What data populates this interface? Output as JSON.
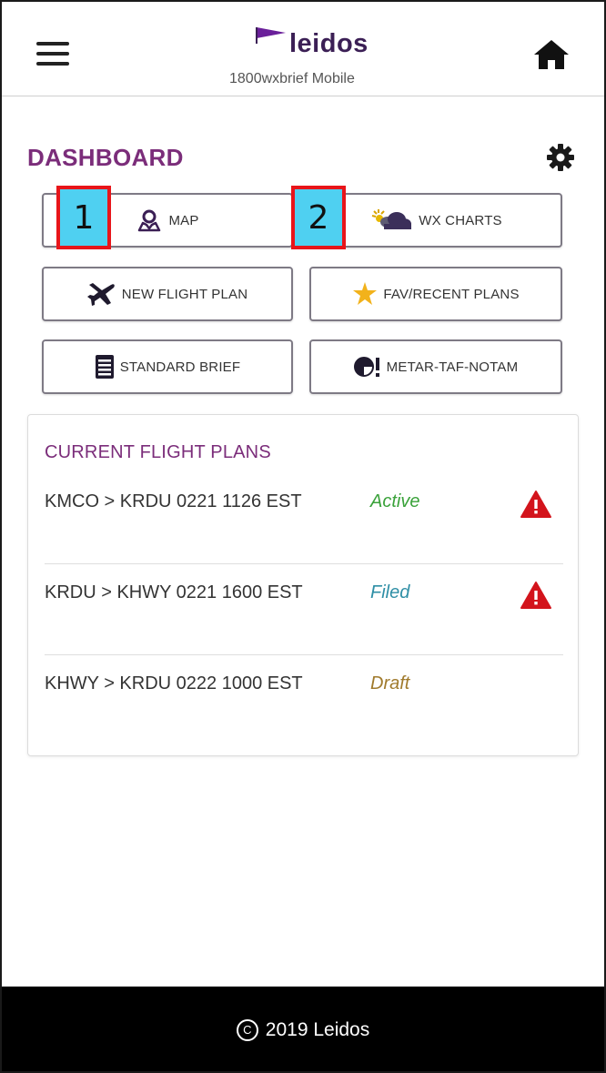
{
  "header": {
    "brand_name": "leidos",
    "subtitle": "1800wxbrief Mobile"
  },
  "dashboard": {
    "title": "DASHBOARD"
  },
  "buttons": {
    "map": "MAP",
    "wx_charts": "WX CHARTS",
    "new_flight_plan": "NEW FLIGHT PLAN",
    "fav_recent_plans": "FAV/RECENT PLANS",
    "standard_brief": "STANDARD BRIEF",
    "metar_taf_notam": "METAR-TAF-NOTAM"
  },
  "markers": {
    "m1": "1",
    "m2": "2"
  },
  "current_flight_plans": {
    "title": "CURRENT FLIGHT PLANS",
    "plans": [
      {
        "route": "KMCO > KRDU 0221 1126 EST",
        "status": "Active",
        "status_color": "#3aa23a",
        "warning": true
      },
      {
        "route": "KRDU > KHWY 0221 1600 EST",
        "status": "Filed",
        "status_color": "#2f8fa6",
        "warning": true
      },
      {
        "route": "KHWY > KRDU 0222 1000 EST",
        "status": "Draft",
        "status_color": "#a07a2c",
        "warning": false
      }
    ]
  },
  "footer": {
    "copyright_symbol": "C",
    "text": "2019 Leidos"
  },
  "colors": {
    "accent": "#7b2d7a",
    "warning": "#d3141c",
    "footer_bg": "#000000",
    "marker_bg": "#4fd0f1",
    "marker_border": "#e8151a"
  }
}
